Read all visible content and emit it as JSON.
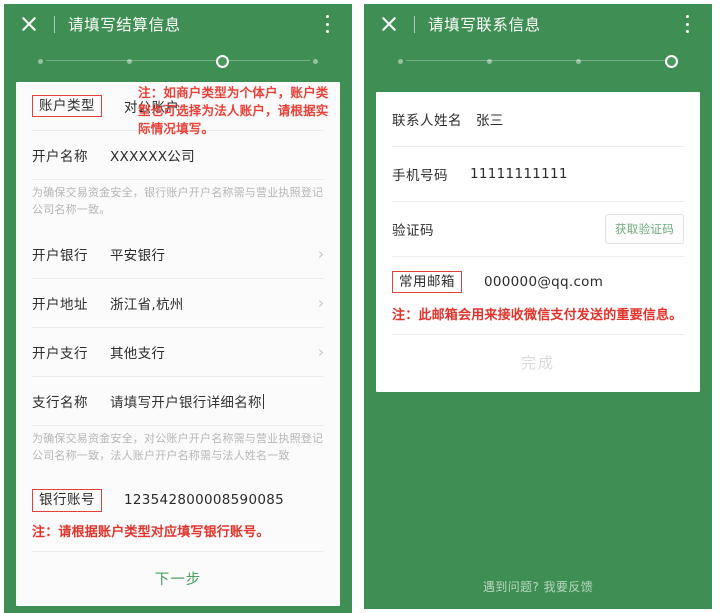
{
  "left": {
    "header": {
      "title": "请填写结算信息",
      "close_icon": "close-icon",
      "menu_icon": "more-vertical-icon"
    },
    "progress": {
      "total": 4,
      "active": 3
    },
    "fields": {
      "account_type": {
        "label": "账户类型",
        "value": "对公账户"
      },
      "account_name": {
        "label": "开户名称",
        "value": "XXXXXX公司"
      },
      "account_name_hint": "为确保交易资金安全，银行账户开户名称需与营业执照登记公司名称一致。",
      "bank": {
        "label": "开户银行",
        "value": "平安银行",
        "chevron": "›"
      },
      "bank_address": {
        "label": "开户地址",
        "value": "浙江省,杭州",
        "chevron": "›"
      },
      "branch": {
        "label": "开户支行",
        "value": "其他支行",
        "chevron": "›"
      },
      "branch_name": {
        "label": "支行名称",
        "placeholder": "请填写开户银行详细名称"
      },
      "branch_name_hint": "为确保交易资金安全，对公账户开户名称需与营业执照登记公司名称一致，法人账户开户名称需与法人姓名一致",
      "bank_account": {
        "label": "银行账号",
        "value": "123542800008590085"
      }
    },
    "annotations": {
      "account_type_note": "注：如商户类型为个体户，账户类型也可选择为法人账户，请根据实际情况填写。",
      "bank_account_note": "注：请根据账户类型对应填写银行账号。"
    },
    "next_button": "下一步"
  },
  "right": {
    "header": {
      "title": "请填写联系信息",
      "close_icon": "close-icon",
      "menu_icon": "more-vertical-icon"
    },
    "progress": {
      "total": 4,
      "active": 4
    },
    "fields": {
      "contact_name": {
        "label": "联系人姓名",
        "value": "张三"
      },
      "phone": {
        "label": "手机号码",
        "value": "11111111111"
      },
      "verify_code": {
        "label": "验证码",
        "button": "获取验证码"
      },
      "email": {
        "label": "常用邮箱",
        "value": "000000@qq.com"
      }
    },
    "annotations": {
      "email_note": "注：此邮箱会用来接收微信支付发送的重要信息。"
    },
    "done_button": "完成",
    "feedback": "遇到问题? 我要反馈"
  },
  "colors": {
    "brand_green": "#3f8f54",
    "red_annotation": "#e2342c",
    "link_green": "#49a05e"
  }
}
